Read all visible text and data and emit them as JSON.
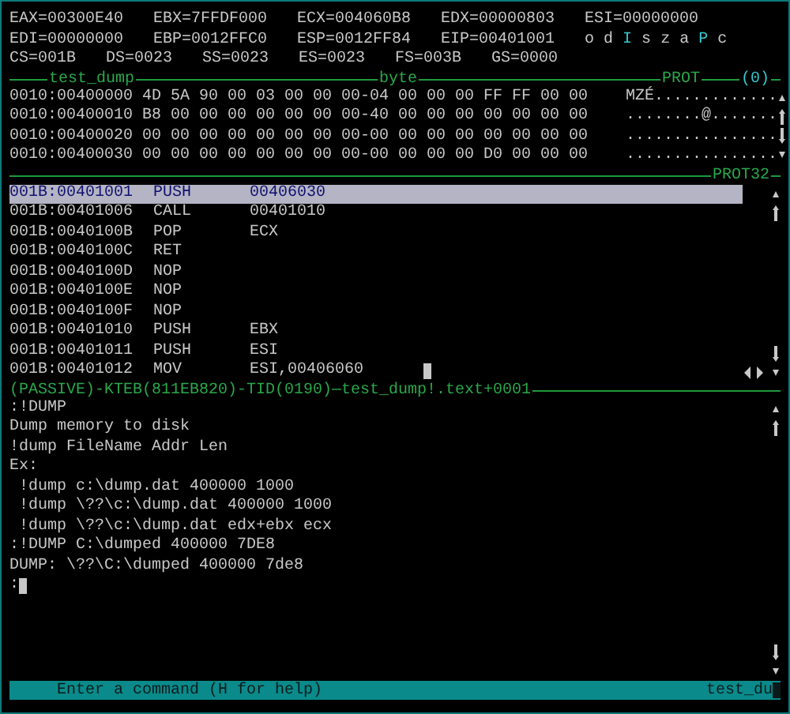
{
  "registers": [
    [
      "EAX=00300E40",
      "EBX=7FFDF000",
      "ECX=004060B8",
      "EDX=00000803",
      "ESI=00000000"
    ],
    [
      "EDI=00000000",
      "EBP=0012FFC0",
      "ESP=0012FF84",
      "EIP=00401001"
    ],
    [
      "CS=001B",
      "DS=0023",
      "SS=0023",
      "ES=0023",
      "FS=003B",
      "GS=0000"
    ]
  ],
  "flags": [
    {
      "label": "o",
      "on": false
    },
    {
      "label": "d",
      "on": false
    },
    {
      "label": "I",
      "on": true
    },
    {
      "label": "s",
      "on": false
    },
    {
      "label": "z",
      "on": false
    },
    {
      "label": "a",
      "on": false
    },
    {
      "label": "P",
      "on": true
    },
    {
      "label": "c",
      "on": false
    }
  ],
  "data_window": {
    "title": "test_dump",
    "format": "byte",
    "mode": "PROT",
    "index": "(0)",
    "rows": [
      {
        "address": "0010:00400000",
        "bytes": "4D 5A 90 00 03 00 00 00-04 00 00 00 FF FF 00 00",
        "ascii": "MZÉ............."
      },
      {
        "address": "0010:00400010",
        "bytes": "B8 00 00 00 00 00 00 00-40 00 00 00 00 00 00 00",
        "ascii": "........@......."
      },
      {
        "address": "0010:00400020",
        "bytes": "00 00 00 00 00 00 00 00-00 00 00 00 00 00 00 00",
        "ascii": "................"
      },
      {
        "address": "0010:00400030",
        "bytes": "00 00 00 00 00 00 00 00-00 00 00 00 D0 00 00 00",
        "ascii": "................"
      }
    ]
  },
  "code_window": {
    "mode": "PROT32",
    "rows": [
      {
        "address": "001B:00401001",
        "mnemonic": "PUSH",
        "operand": "00406030",
        "selected": true
      },
      {
        "address": "001B:00401006",
        "mnemonic": "CALL",
        "operand": "00401010",
        "selected": false
      },
      {
        "address": "001B:0040100B",
        "mnemonic": "POP",
        "operand": "ECX",
        "selected": false
      },
      {
        "address": "001B:0040100C",
        "mnemonic": "RET",
        "operand": "",
        "selected": false
      },
      {
        "address": "001B:0040100D",
        "mnemonic": "NOP",
        "operand": "",
        "selected": false
      },
      {
        "address": "001B:0040100E",
        "mnemonic": "NOP",
        "operand": "",
        "selected": false
      },
      {
        "address": "001B:0040100F",
        "mnemonic": "NOP",
        "operand": "",
        "selected": false
      },
      {
        "address": "001B:00401010",
        "mnemonic": "PUSH",
        "operand": "EBX",
        "selected": false
      },
      {
        "address": "001B:00401011",
        "mnemonic": "PUSH",
        "operand": "ESI",
        "selected": false
      },
      {
        "address": "001B:00401012",
        "mnemonic": "MOV",
        "operand": "ESI,00406060",
        "selected": false
      }
    ]
  },
  "context_line": "(PASSIVE)-KTEB(811EB820)-TID(0190)—test_dump!.text+0001",
  "command_lines": [
    ":!DUMP",
    "Dump memory to disk",
    "!dump FileName Addr Len",
    "Ex:",
    " !dump c:\\dump.dat 400000 1000",
    " !dump \\??\\c:\\dump.dat 400000 1000",
    " !dump \\??\\c:\\dump.dat edx+ebx ecx",
    ":!DUMP C:\\dumped 400000 7DE8",
    "DUMP: \\??\\C:\\dumped 400000 7de8"
  ],
  "prompt": ":",
  "status_bar": {
    "hint": "Enter a command (H for help)",
    "module": "test_du"
  }
}
